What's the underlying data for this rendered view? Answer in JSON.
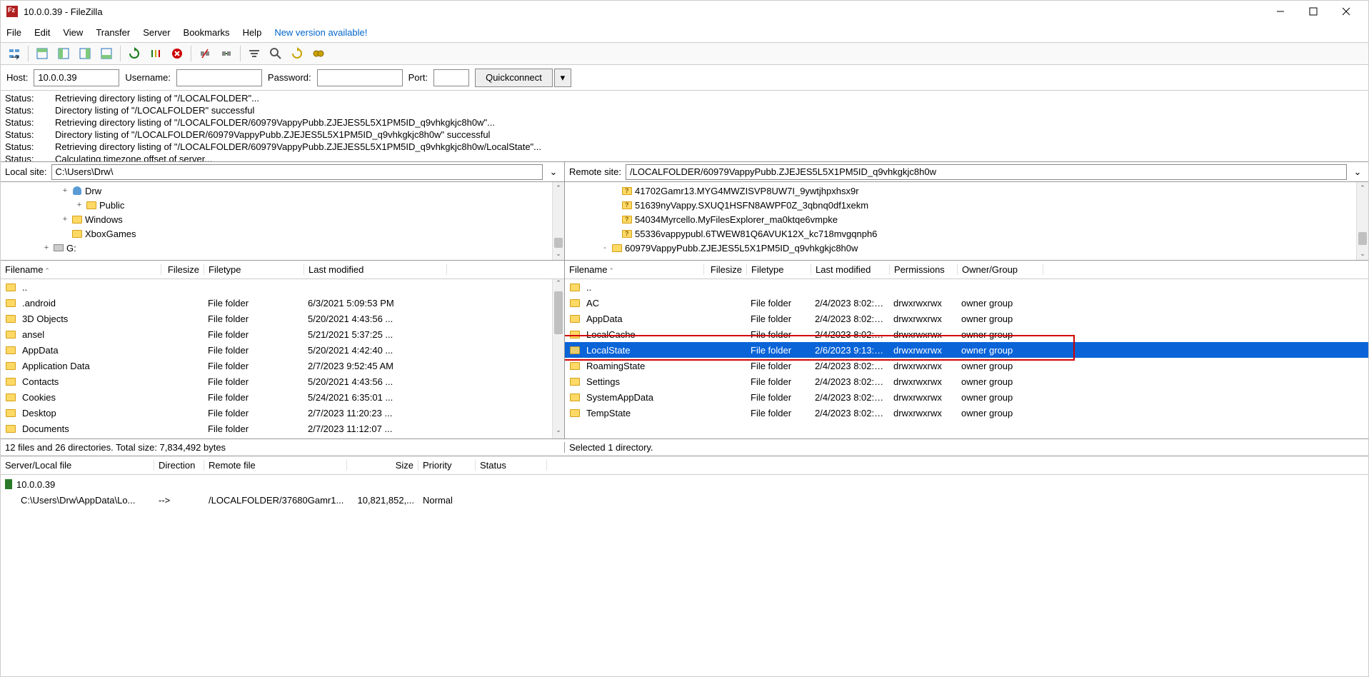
{
  "window_title": "10.0.0.39 - FileZilla",
  "menu": [
    "File",
    "Edit",
    "View",
    "Transfer",
    "Server",
    "Bookmarks",
    "Help"
  ],
  "new_version_text": "New version available!",
  "quickconnect": {
    "host_label": "Host:",
    "host_value": "10.0.0.39",
    "user_label": "Username:",
    "user_value": "",
    "pass_label": "Password:",
    "pass_value": "",
    "port_label": "Port:",
    "port_value": "",
    "button": "Quickconnect"
  },
  "log_lines": [
    {
      "label": "Status:",
      "msg": "Retrieving directory listing of \"/LOCALFOLDER\"..."
    },
    {
      "label": "Status:",
      "msg": "Directory listing of \"/LOCALFOLDER\" successful"
    },
    {
      "label": "Status:",
      "msg": "Retrieving directory listing of \"/LOCALFOLDER/60979VappyPubb.ZJEJES5L5X1PM5ID_q9vhkgkjc8h0w\"..."
    },
    {
      "label": "Status:",
      "msg": "Directory listing of \"/LOCALFOLDER/60979VappyPubb.ZJEJES5L5X1PM5ID_q9vhkgkjc8h0w\" successful"
    },
    {
      "label": "Status:",
      "msg": "Retrieving directory listing of \"/LOCALFOLDER/60979VappyPubb.ZJEJES5L5X1PM5ID_q9vhkgkjc8h0w/LocalState\"..."
    },
    {
      "label": "Status:",
      "msg": "Calculating timezone offset of server..."
    }
  ],
  "local_site": {
    "label": "Local site:",
    "value": "C:\\Users\\Drw\\"
  },
  "remote_site": {
    "label": "Remote site:",
    "value": "/LOCALFOLDER/60979VappyPubb.ZJEJES5L5X1PM5ID_q9vhkgkjc8h0w"
  },
  "local_tree": [
    {
      "indent": 80,
      "exp": "+",
      "icon": "user",
      "name": "Drw"
    },
    {
      "indent": 100,
      "exp": "+",
      "icon": "folder",
      "name": "Public"
    },
    {
      "indent": 80,
      "exp": "+",
      "icon": "folder",
      "name": "Windows"
    },
    {
      "indent": 80,
      "exp": "",
      "icon": "folder",
      "name": "XboxGames"
    },
    {
      "indent": 54,
      "exp": "+",
      "icon": "drive",
      "name": "G:"
    }
  ],
  "remote_tree": [
    {
      "indent": 60,
      "exp": "",
      "icon": "folderq",
      "name": "41702Gamr13.MYG4MWZISVP8UW7I_9ywtjhpxhsx9r"
    },
    {
      "indent": 60,
      "exp": "",
      "icon": "folderq",
      "name": "51639nyVappy.SXUQ1HSFN8AWPF0Z_3qbnq0df1xekm"
    },
    {
      "indent": 60,
      "exp": "",
      "icon": "folderq",
      "name": "54034Myrcello.MyFilesExplorer_ma0ktqe6vmpke"
    },
    {
      "indent": 60,
      "exp": "",
      "icon": "folderq",
      "name": "55336vappypubl.6TWEW81Q6AVUK12X_kc718mvgqnph6"
    },
    {
      "indent": 46,
      "exp": "-",
      "icon": "folder",
      "name": "60979VappyPubb.ZJEJES5L5X1PM5ID_q9vhkgkjc8h0w"
    }
  ],
  "local_columns": [
    "Filename",
    "Filesize",
    "Filetype",
    "Last modified"
  ],
  "local_files": [
    {
      "name": "..",
      "size": "",
      "type": "",
      "mod": ""
    },
    {
      "name": ".android",
      "size": "",
      "type": "File folder",
      "mod": "6/3/2021 5:09:53 PM"
    },
    {
      "name": "3D Objects",
      "size": "",
      "type": "File folder",
      "mod": "5/20/2021 4:43:56 ..."
    },
    {
      "name": "ansel",
      "size": "",
      "type": "File folder",
      "mod": "5/21/2021 5:37:25 ..."
    },
    {
      "name": "AppData",
      "size": "",
      "type": "File folder",
      "mod": "5/20/2021 4:42:40 ..."
    },
    {
      "name": "Application Data",
      "size": "",
      "type": "File folder",
      "mod": "2/7/2023 9:52:45 AM"
    },
    {
      "name": "Contacts",
      "size": "",
      "type": "File folder",
      "mod": "5/20/2021 4:43:56 ..."
    },
    {
      "name": "Cookies",
      "size": "",
      "type": "File folder",
      "mod": "5/24/2021 6:35:01 ..."
    },
    {
      "name": "Desktop",
      "size": "",
      "type": "File folder",
      "mod": "2/7/2023 11:20:23 ..."
    },
    {
      "name": "Documents",
      "size": "",
      "type": "File folder",
      "mod": "2/7/2023 11:12:07 ..."
    }
  ],
  "remote_columns": [
    "Filename",
    "Filesize",
    "Filetype",
    "Last modified",
    "Permissions",
    "Owner/Group"
  ],
  "remote_files": [
    {
      "name": "..",
      "size": "",
      "type": "",
      "mod": "",
      "perm": "",
      "owner": "",
      "sel": false
    },
    {
      "name": "AC",
      "size": "",
      "type": "File folder",
      "mod": "2/4/2023 8:02:0...",
      "perm": "drwxrwxrwx",
      "owner": "owner group",
      "sel": false
    },
    {
      "name": "AppData",
      "size": "",
      "type": "File folder",
      "mod": "2/4/2023 8:02:0...",
      "perm": "drwxrwxrwx",
      "owner": "owner group",
      "sel": false
    },
    {
      "name": "LocalCache",
      "size": "",
      "type": "File folder",
      "mod": "2/4/2023 8:02:0...",
      "perm": "drwxrwxrwx",
      "owner": "owner group",
      "sel": false
    },
    {
      "name": "LocalState",
      "size": "",
      "type": "File folder",
      "mod": "2/6/2023 9:13:0...",
      "perm": "drwxrwxrwx",
      "owner": "owner group",
      "sel": true
    },
    {
      "name": "RoamingState",
      "size": "",
      "type": "File folder",
      "mod": "2/4/2023 8:02:0...",
      "perm": "drwxrwxrwx",
      "owner": "owner group",
      "sel": false
    },
    {
      "name": "Settings",
      "size": "",
      "type": "File folder",
      "mod": "2/4/2023 8:02:0...",
      "perm": "drwxrwxrwx",
      "owner": "owner group",
      "sel": false
    },
    {
      "name": "SystemAppData",
      "size": "",
      "type": "File folder",
      "mod": "2/4/2023 8:02:0...",
      "perm": "drwxrwxrwx",
      "owner": "owner group",
      "sel": false
    },
    {
      "name": "TempState",
      "size": "",
      "type": "File folder",
      "mod": "2/4/2023 8:02:0...",
      "perm": "drwxrwxrwx",
      "owner": "owner group",
      "sel": false
    }
  ],
  "local_status": "12 files and 26 directories. Total size: 7,834,492 bytes",
  "remote_status": "Selected 1 directory.",
  "queue_columns": [
    "Server/Local file",
    "Direction",
    "Remote file",
    "Size",
    "Priority",
    "Status"
  ],
  "queue_server": "10.0.0.39",
  "queue_item": {
    "local": "C:\\Users\\Drw\\AppData\\Lo...",
    "dir": "-->",
    "remote": "/LOCALFOLDER/37680Gamr1...",
    "size": "10,821,852,...",
    "priority": "Normal",
    "status": ""
  }
}
